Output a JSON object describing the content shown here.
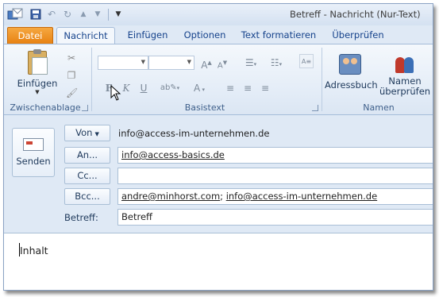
{
  "window": {
    "title": "Betreff - Nachricht (Nur-Text)"
  },
  "quick_access": {
    "save_icon": "save-icon",
    "undo_icon": "undo-icon",
    "redo_icon": "redo-icon",
    "more_icon": "chevron-down-icon"
  },
  "tabs": {
    "datei": "Datei",
    "nachricht": "Nachricht",
    "einfuegen": "Einfügen",
    "optionen": "Optionen",
    "formatieren": "Text formatieren",
    "pruefen": "Überprüfen",
    "active": "Nachricht"
  },
  "ribbon": {
    "clipboard": {
      "paste_label": "Einfügen",
      "group_label": "Zwischenablage"
    },
    "basictext": {
      "group_label": "Basistext",
      "font_value": "",
      "size_value": "",
      "bold": "F",
      "italic": "K",
      "underline": "U",
      "grow": "A",
      "shrink": "A",
      "fontcolor": "A"
    },
    "names": {
      "addressbook_label": "Adressbuch",
      "checknames_label_1": "Namen",
      "checknames_label_2": "überprüfen",
      "group_label": "Namen"
    }
  },
  "compose": {
    "send_label": "Senden",
    "from_button": "Von",
    "from_address": "info@access-im-unternehmen.de",
    "to_button": "An...",
    "to_recipients": [
      "info@access-basics.de"
    ],
    "cc_button": "Cc...",
    "cc_recipients": [],
    "bcc_button": "Bcc...",
    "bcc_recipients": [
      "andre@minhorst.com",
      "info@access-im-unternehmen.de"
    ],
    "subject_label": "Betreff:",
    "subject_value": "Betreff"
  },
  "body": {
    "text": "Inhalt"
  },
  "colors": {
    "accent_file_tab": "#e67f10",
    "ribbon_bg": "#dfe9f5",
    "tab_text": "#15428b"
  }
}
